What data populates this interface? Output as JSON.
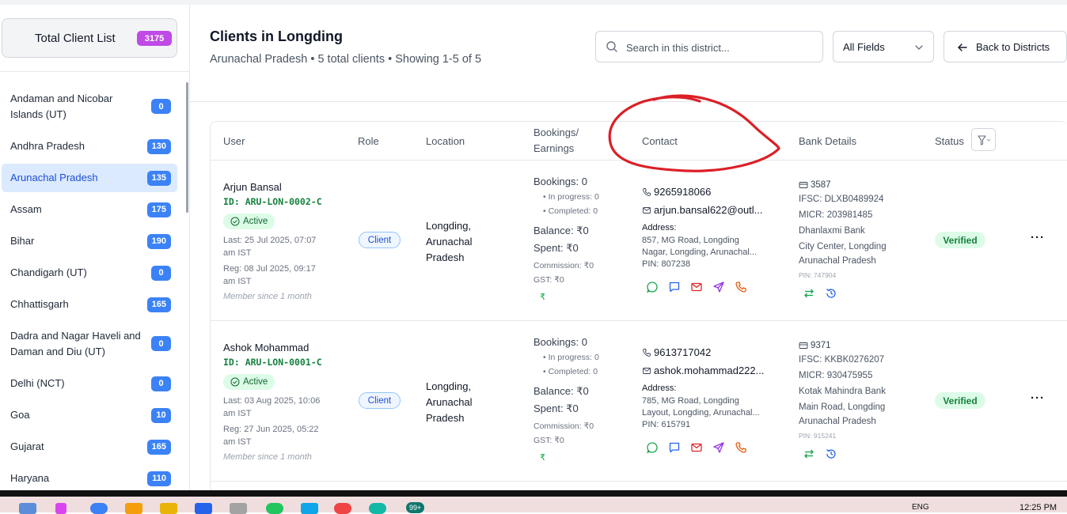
{
  "sidebar": {
    "total_label": "Total Client List",
    "total_count": "3175",
    "states": [
      {
        "name": "Andaman and Nicobar Islands (UT)",
        "count": "0"
      },
      {
        "name": "Andhra Pradesh",
        "count": "130"
      },
      {
        "name": "Arunachal Pradesh",
        "count": "135",
        "active": true
      },
      {
        "name": "Assam",
        "count": "175"
      },
      {
        "name": "Bihar",
        "count": "190"
      },
      {
        "name": "Chandigarh (UT)",
        "count": "0"
      },
      {
        "name": "Chhattisgarh",
        "count": "165"
      },
      {
        "name": "Dadra and Nagar Haveli and Daman and Diu (UT)",
        "count": "0"
      },
      {
        "name": "Delhi (NCT)",
        "count": "0"
      },
      {
        "name": "Goa",
        "count": "10"
      },
      {
        "name": "Gujarat",
        "count": "165"
      },
      {
        "name": "Haryana",
        "count": "110"
      }
    ]
  },
  "header": {
    "title": "Clients in Longding",
    "subtitle": "Arunachal Pradesh • 5 total clients • Showing 1-5 of 5",
    "search_placeholder": "Search in this district...",
    "field_select": "All Fields",
    "back_label": "Back to Districts"
  },
  "table": {
    "columns": {
      "user": "User",
      "role": "Role",
      "location": "Location",
      "bookings_l1": "Bookings/",
      "bookings_l2": "Earnings",
      "contact": "Contact",
      "bank": "Bank Details",
      "status": "Status"
    },
    "rows": [
      {
        "name": "Arjun Bansal",
        "id": "ID: ARU-LON-0002-C",
        "state": "Active",
        "last_1": "Last: 25 Jul 2025, 07:07",
        "last_2": "am IST",
        "reg_1": "Reg: 08 Jul 2025, 09:17",
        "reg_2": "am IST",
        "member": "Member since 1 month",
        "role": "Client",
        "loc_1": "Longding,",
        "loc_2": "Arunachal",
        "loc_3": "Pradesh",
        "bookings": "Bookings: 0",
        "in_progress": "• In progress: 0",
        "completed": "• Completed: 0",
        "balance": "Balance: ₹0",
        "spent": "Spent: ₹0",
        "commission": "Commission: ₹0",
        "gst": "GST: ₹0",
        "rupee": "₹",
        "phone": "9265918066",
        "email": "arjun.bansal622@outl...",
        "address_label": "Address:",
        "addr_1": "857, MG Road, Longding",
        "addr_2": "Nagar, Longding, Arunachal...",
        "pin": "PIN: 807238",
        "acct": "3587",
        "ifsc": "IFSC: DLXB0489924",
        "micr": "MICR: 203981485",
        "bank_name": "Dhanlaxmi Bank",
        "branch_1": "City Center, Longding",
        "branch_2": "Arunachal Pradesh",
        "bank_pin": "PIN: 747904",
        "status": "Verified",
        "more": "···"
      },
      {
        "name": "Ashok Mohammad",
        "id": "ID: ARU-LON-0001-C",
        "state": "Active",
        "last_1": "Last: 03 Aug 2025, 10:06",
        "last_2": "am IST",
        "reg_1": "Reg: 27 Jun 2025, 05:22",
        "reg_2": "am IST",
        "member": "Member since 1 month",
        "role": "Client",
        "loc_1": "Longding,",
        "loc_2": "Arunachal",
        "loc_3": "Pradesh",
        "bookings": "Bookings: 0",
        "in_progress": "• In progress: 0",
        "completed": "• Completed: 0",
        "balance": "Balance: ₹0",
        "spent": "Spent: ₹0",
        "commission": "Commission: ₹0",
        "gst": "GST: ₹0",
        "rupee": "₹",
        "phone": "9613717042",
        "email": "ashok.mohammad222...",
        "address_label": "Address:",
        "addr_1": "785, MG Road, Longding",
        "addr_2": "Layout, Longding, Arunachal...",
        "pin": "PIN: 615791",
        "acct": "9371",
        "ifsc": "IFSC: KKBK0276207",
        "micr": "MICR: 930475955",
        "bank_name": "Kotak Mahindra Bank",
        "branch_1": "Main Road, Longding",
        "branch_2": "Arunachal Pradesh",
        "bank_pin": "PIN: 915241",
        "status": "Verified",
        "more": "···"
      }
    ]
  },
  "taskbar": {
    "badge": "99+",
    "lang": "ENG",
    "time": "12:25 PM"
  },
  "colors": {
    "accent": "#3b82f6",
    "total_badge": "#c04ae6",
    "active_green": "#15803d",
    "annotation_red": "#dc1f26"
  }
}
